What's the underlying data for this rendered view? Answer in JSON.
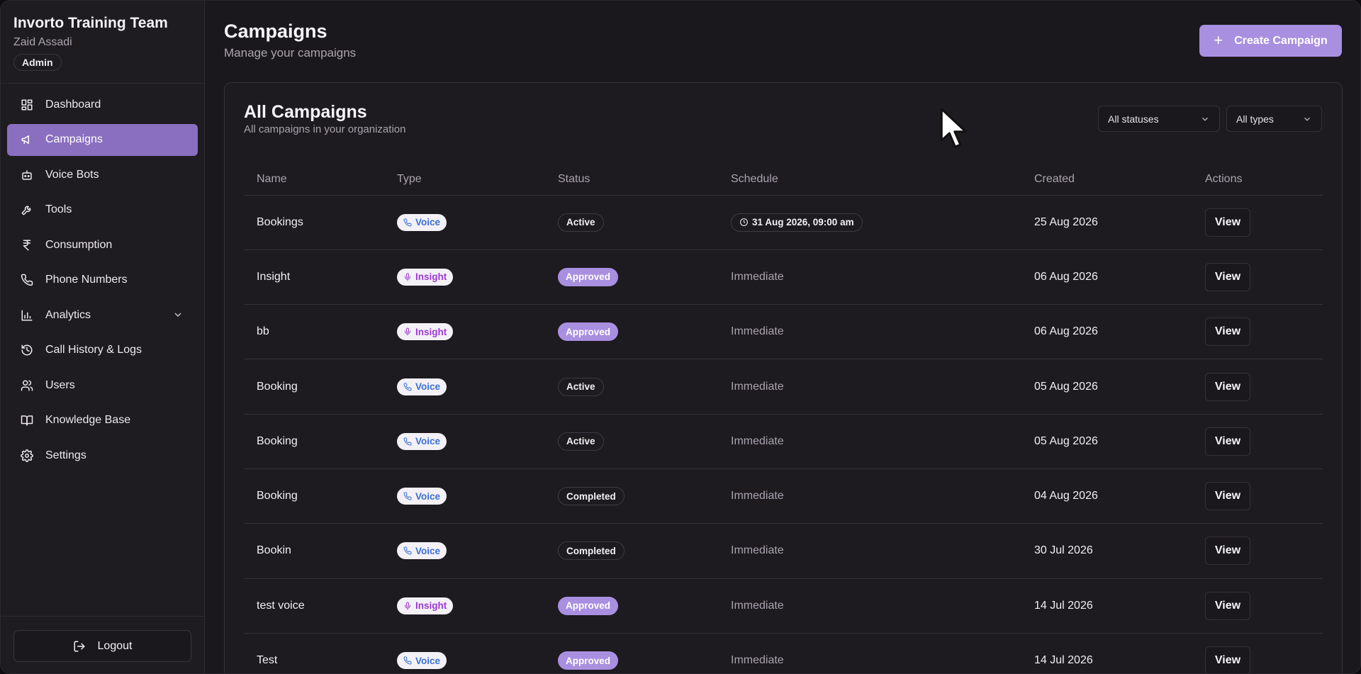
{
  "sidebar": {
    "org_name": "Invorto Training Team",
    "user_name": "Zaid Assadi",
    "role": "Admin",
    "items": [
      {
        "label": "Dashboard",
        "icon": "dashboard-icon",
        "active": false
      },
      {
        "label": "Campaigns",
        "icon": "megaphone-icon",
        "active": true
      },
      {
        "label": "Voice Bots",
        "icon": "bot-icon",
        "active": false
      },
      {
        "label": "Tools",
        "icon": "wrench-icon",
        "active": false
      },
      {
        "label": "Consumption",
        "icon": "rupee-icon",
        "active": false
      },
      {
        "label": "Phone Numbers",
        "icon": "phone-icon",
        "active": false
      },
      {
        "label": "Analytics",
        "icon": "bar-chart-icon",
        "active": false,
        "expandable": true
      },
      {
        "label": "Call History & Logs",
        "icon": "history-icon",
        "active": false
      },
      {
        "label": "Users",
        "icon": "users-icon",
        "active": false
      },
      {
        "label": "Knowledge Base",
        "icon": "book-icon",
        "active": false
      },
      {
        "label": "Settings",
        "icon": "gear-icon",
        "active": false
      }
    ],
    "logout_label": "Logout"
  },
  "header": {
    "title": "Campaigns",
    "subtitle": "Manage your campaigns",
    "create_button": "Create Campaign"
  },
  "card": {
    "title": "All Campaigns",
    "subtitle": "All campaigns in your organization",
    "status_filter": "All statuses",
    "type_filter": "All types"
  },
  "table": {
    "columns": [
      "Name",
      "Type",
      "Status",
      "Schedule",
      "Created",
      "Actions"
    ],
    "rows": [
      {
        "name": "Bookings",
        "type": "Voice",
        "status": "Active",
        "schedule": "31 Aug 2026, 09:00 am",
        "scheduled": true,
        "created": "25 Aug 2026",
        "action": "View"
      },
      {
        "name": "Insight",
        "type": "Insight",
        "status": "Approved",
        "schedule": "Immediate",
        "scheduled": false,
        "created": "06 Aug 2026",
        "action": "View"
      },
      {
        "name": "bb",
        "type": "Insight",
        "status": "Approved",
        "schedule": "Immediate",
        "scheduled": false,
        "created": "06 Aug 2026",
        "action": "View"
      },
      {
        "name": "Booking",
        "type": "Voice",
        "status": "Active",
        "schedule": "Immediate",
        "scheduled": false,
        "created": "05 Aug 2026",
        "action": "View"
      },
      {
        "name": "Booking",
        "type": "Voice",
        "status": "Active",
        "schedule": "Immediate",
        "scheduled": false,
        "created": "05 Aug 2026",
        "action": "View"
      },
      {
        "name": "Booking",
        "type": "Voice",
        "status": "Completed",
        "schedule": "Immediate",
        "scheduled": false,
        "created": "04 Aug 2026",
        "action": "View"
      },
      {
        "name": "Bookin",
        "type": "Voice",
        "status": "Completed",
        "schedule": "Immediate",
        "scheduled": false,
        "created": "30 Jul 2026",
        "action": "View"
      },
      {
        "name": "test voice",
        "type": "Insight",
        "status": "Approved",
        "schedule": "Immediate",
        "scheduled": false,
        "created": "14 Jul 2026",
        "action": "View"
      },
      {
        "name": "Test",
        "type": "Voice",
        "status": "Approved",
        "schedule": "Immediate",
        "scheduled": false,
        "created": "14 Jul 2026",
        "action": "View"
      }
    ]
  },
  "colors": {
    "accent": "#a98fe0",
    "active_nav": "#8a6fc0",
    "voice": "#3b6fd3",
    "insight": "#9b3bd0"
  }
}
